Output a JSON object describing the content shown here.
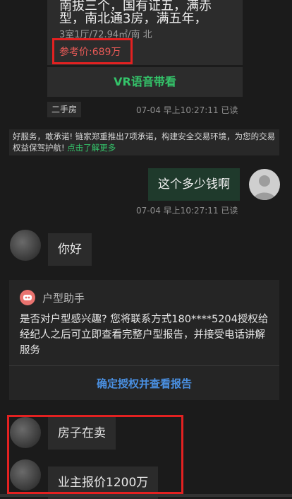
{
  "listing": {
    "line1": "南拔三个，国有证五，满赤",
    "line2": "型，南北通3房，满五年，",
    "meta": "3室1厅/72.94㎡/南 北",
    "price": "参考价:689万",
    "vr_button": "VR语音带看",
    "tag": "二手房",
    "timestamp": "07-04 早上10:27:11 已读"
  },
  "notice": {
    "text": "好服务，敢承诺! 链家郑重推出7项承诺，构建安全交易环境，为您的交易权益保驾护航! ",
    "link": "点击了解更多"
  },
  "messages": {
    "user_msg": "这个多少钱啊",
    "user_timestamp": "07-04 早上10:27:11 已读",
    "agent_hello": "你好",
    "agent_selling": "房子在卖",
    "agent_price": "业主报价1200万"
  },
  "assistant": {
    "title": "户型助手",
    "text": "是否对户型感兴趣? 您将联系方式180****5204授权给经纪人之后可立即查看完整户型报告，并接受电话讲解服务",
    "action": "确定授权并查看报告"
  },
  "colors": {
    "background": "#1b1b1b",
    "accent_green": "#34c46a",
    "price_red": "#e85a57",
    "highlight_red": "#e32121",
    "link_blue": "#4a90e2"
  }
}
